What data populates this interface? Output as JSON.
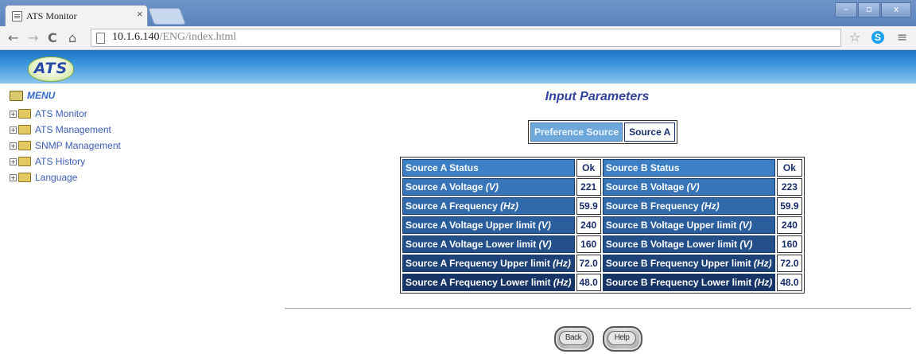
{
  "browser": {
    "tab_title": "ATS Monitor",
    "tab_close": "×",
    "url_host": "10.1.6.140",
    "url_path": "/ENG/index.html",
    "window_buttons": [
      "–",
      "▫",
      "x"
    ]
  },
  "header": {
    "logo_text": "ATS"
  },
  "sidebar": {
    "root_label": "MENU",
    "items": [
      {
        "label": "ATS Monitor"
      },
      {
        "label": "ATS Management"
      },
      {
        "label": "SNMP Management"
      },
      {
        "label": "ATS History"
      },
      {
        "label": "Language"
      }
    ]
  },
  "main": {
    "title": "Input Parameters",
    "preference": {
      "label": "Preference Source",
      "value": "Source A"
    },
    "rows": [
      {
        "a_label": "Source A Status",
        "a_unit": "",
        "a_value": "Ok",
        "b_label": "Source B Status",
        "b_unit": "",
        "b_value": "Ok"
      },
      {
        "a_label": "Source A Voltage ",
        "a_unit": "(V)",
        "a_value": "221",
        "b_label": "Source B Voltage ",
        "b_unit": "(V)",
        "b_value": "223"
      },
      {
        "a_label": "Source A Frequency ",
        "a_unit": "(Hz)",
        "a_value": "59.9",
        "b_label": "Source B Frequency ",
        "b_unit": "(Hz)",
        "b_value": "59.9"
      },
      {
        "a_label": "Source A Voltage Upper limit ",
        "a_unit": "(V)",
        "a_value": "240",
        "b_label": "Source B Voltage Upper limit ",
        "b_unit": "(V)",
        "b_value": "240"
      },
      {
        "a_label": "Source A Voltage Lower limit ",
        "a_unit": "(V)",
        "a_value": "160",
        "b_label": "Source B Voltage Lower limit ",
        "b_unit": "(V)",
        "b_value": "160"
      },
      {
        "a_label": "Source A Frequency Upper limit ",
        "a_unit": "(Hz)",
        "a_value": "72.0",
        "b_label": "Source B Frequency Upper limit ",
        "b_unit": "(Hz)",
        "b_value": "72.0"
      },
      {
        "a_label": "Source A Frequency Lower limit ",
        "a_unit": "(Hz)",
        "a_value": "48.0",
        "b_label": "Source B Frequency Lower limit ",
        "b_unit": "(Hz)",
        "b_value": "48.0"
      }
    ],
    "buttons": {
      "back": "Back",
      "help": "Help"
    }
  }
}
